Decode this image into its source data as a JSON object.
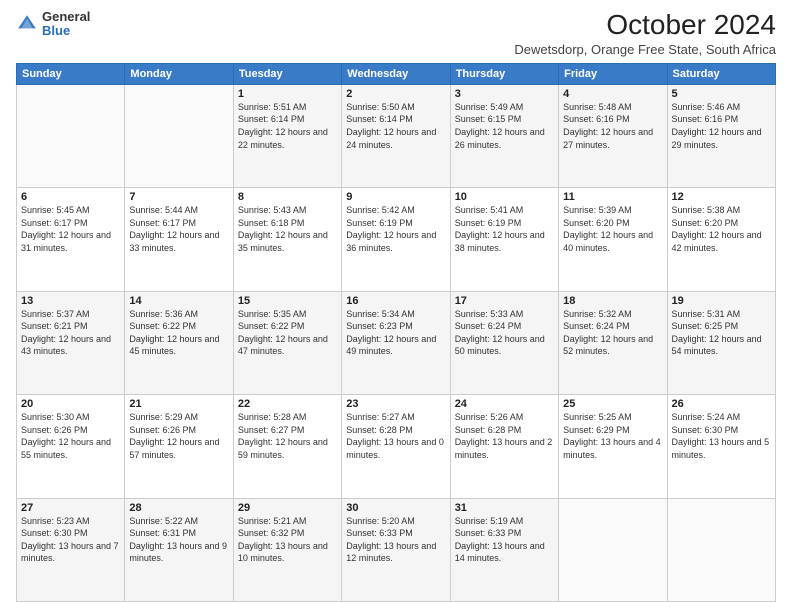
{
  "logo": {
    "general": "General",
    "blue": "Blue"
  },
  "title": "October 2024",
  "subtitle": "Dewetsdorp, Orange Free State, South Africa",
  "headers": [
    "Sunday",
    "Monday",
    "Tuesday",
    "Wednesday",
    "Thursday",
    "Friday",
    "Saturday"
  ],
  "weeks": [
    [
      {
        "day": "",
        "detail": ""
      },
      {
        "day": "",
        "detail": ""
      },
      {
        "day": "1",
        "detail": "Sunrise: 5:51 AM\nSunset: 6:14 PM\nDaylight: 12 hours and 22 minutes."
      },
      {
        "day": "2",
        "detail": "Sunrise: 5:50 AM\nSunset: 6:14 PM\nDaylight: 12 hours and 24 minutes."
      },
      {
        "day": "3",
        "detail": "Sunrise: 5:49 AM\nSunset: 6:15 PM\nDaylight: 12 hours and 26 minutes."
      },
      {
        "day": "4",
        "detail": "Sunrise: 5:48 AM\nSunset: 6:16 PM\nDaylight: 12 hours and 27 minutes."
      },
      {
        "day": "5",
        "detail": "Sunrise: 5:46 AM\nSunset: 6:16 PM\nDaylight: 12 hours and 29 minutes."
      }
    ],
    [
      {
        "day": "6",
        "detail": "Sunrise: 5:45 AM\nSunset: 6:17 PM\nDaylight: 12 hours and 31 minutes."
      },
      {
        "day": "7",
        "detail": "Sunrise: 5:44 AM\nSunset: 6:17 PM\nDaylight: 12 hours and 33 minutes."
      },
      {
        "day": "8",
        "detail": "Sunrise: 5:43 AM\nSunset: 6:18 PM\nDaylight: 12 hours and 35 minutes."
      },
      {
        "day": "9",
        "detail": "Sunrise: 5:42 AM\nSunset: 6:19 PM\nDaylight: 12 hours and 36 minutes."
      },
      {
        "day": "10",
        "detail": "Sunrise: 5:41 AM\nSunset: 6:19 PM\nDaylight: 12 hours and 38 minutes."
      },
      {
        "day": "11",
        "detail": "Sunrise: 5:39 AM\nSunset: 6:20 PM\nDaylight: 12 hours and 40 minutes."
      },
      {
        "day": "12",
        "detail": "Sunrise: 5:38 AM\nSunset: 6:20 PM\nDaylight: 12 hours and 42 minutes."
      }
    ],
    [
      {
        "day": "13",
        "detail": "Sunrise: 5:37 AM\nSunset: 6:21 PM\nDaylight: 12 hours and 43 minutes."
      },
      {
        "day": "14",
        "detail": "Sunrise: 5:36 AM\nSunset: 6:22 PM\nDaylight: 12 hours and 45 minutes."
      },
      {
        "day": "15",
        "detail": "Sunrise: 5:35 AM\nSunset: 6:22 PM\nDaylight: 12 hours and 47 minutes."
      },
      {
        "day": "16",
        "detail": "Sunrise: 5:34 AM\nSunset: 6:23 PM\nDaylight: 12 hours and 49 minutes."
      },
      {
        "day": "17",
        "detail": "Sunrise: 5:33 AM\nSunset: 6:24 PM\nDaylight: 12 hours and 50 minutes."
      },
      {
        "day": "18",
        "detail": "Sunrise: 5:32 AM\nSunset: 6:24 PM\nDaylight: 12 hours and 52 minutes."
      },
      {
        "day": "19",
        "detail": "Sunrise: 5:31 AM\nSunset: 6:25 PM\nDaylight: 12 hours and 54 minutes."
      }
    ],
    [
      {
        "day": "20",
        "detail": "Sunrise: 5:30 AM\nSunset: 6:26 PM\nDaylight: 12 hours and 55 minutes."
      },
      {
        "day": "21",
        "detail": "Sunrise: 5:29 AM\nSunset: 6:26 PM\nDaylight: 12 hours and 57 minutes."
      },
      {
        "day": "22",
        "detail": "Sunrise: 5:28 AM\nSunset: 6:27 PM\nDaylight: 12 hours and 59 minutes."
      },
      {
        "day": "23",
        "detail": "Sunrise: 5:27 AM\nSunset: 6:28 PM\nDaylight: 13 hours and 0 minutes."
      },
      {
        "day": "24",
        "detail": "Sunrise: 5:26 AM\nSunset: 6:28 PM\nDaylight: 13 hours and 2 minutes."
      },
      {
        "day": "25",
        "detail": "Sunrise: 5:25 AM\nSunset: 6:29 PM\nDaylight: 13 hours and 4 minutes."
      },
      {
        "day": "26",
        "detail": "Sunrise: 5:24 AM\nSunset: 6:30 PM\nDaylight: 13 hours and 5 minutes."
      }
    ],
    [
      {
        "day": "27",
        "detail": "Sunrise: 5:23 AM\nSunset: 6:30 PM\nDaylight: 13 hours and 7 minutes."
      },
      {
        "day": "28",
        "detail": "Sunrise: 5:22 AM\nSunset: 6:31 PM\nDaylight: 13 hours and 9 minutes."
      },
      {
        "day": "29",
        "detail": "Sunrise: 5:21 AM\nSunset: 6:32 PM\nDaylight: 13 hours and 10 minutes."
      },
      {
        "day": "30",
        "detail": "Sunrise: 5:20 AM\nSunset: 6:33 PM\nDaylight: 13 hours and 12 minutes."
      },
      {
        "day": "31",
        "detail": "Sunrise: 5:19 AM\nSunset: 6:33 PM\nDaylight: 13 hours and 14 minutes."
      },
      {
        "day": "",
        "detail": ""
      },
      {
        "day": "",
        "detail": ""
      }
    ]
  ]
}
